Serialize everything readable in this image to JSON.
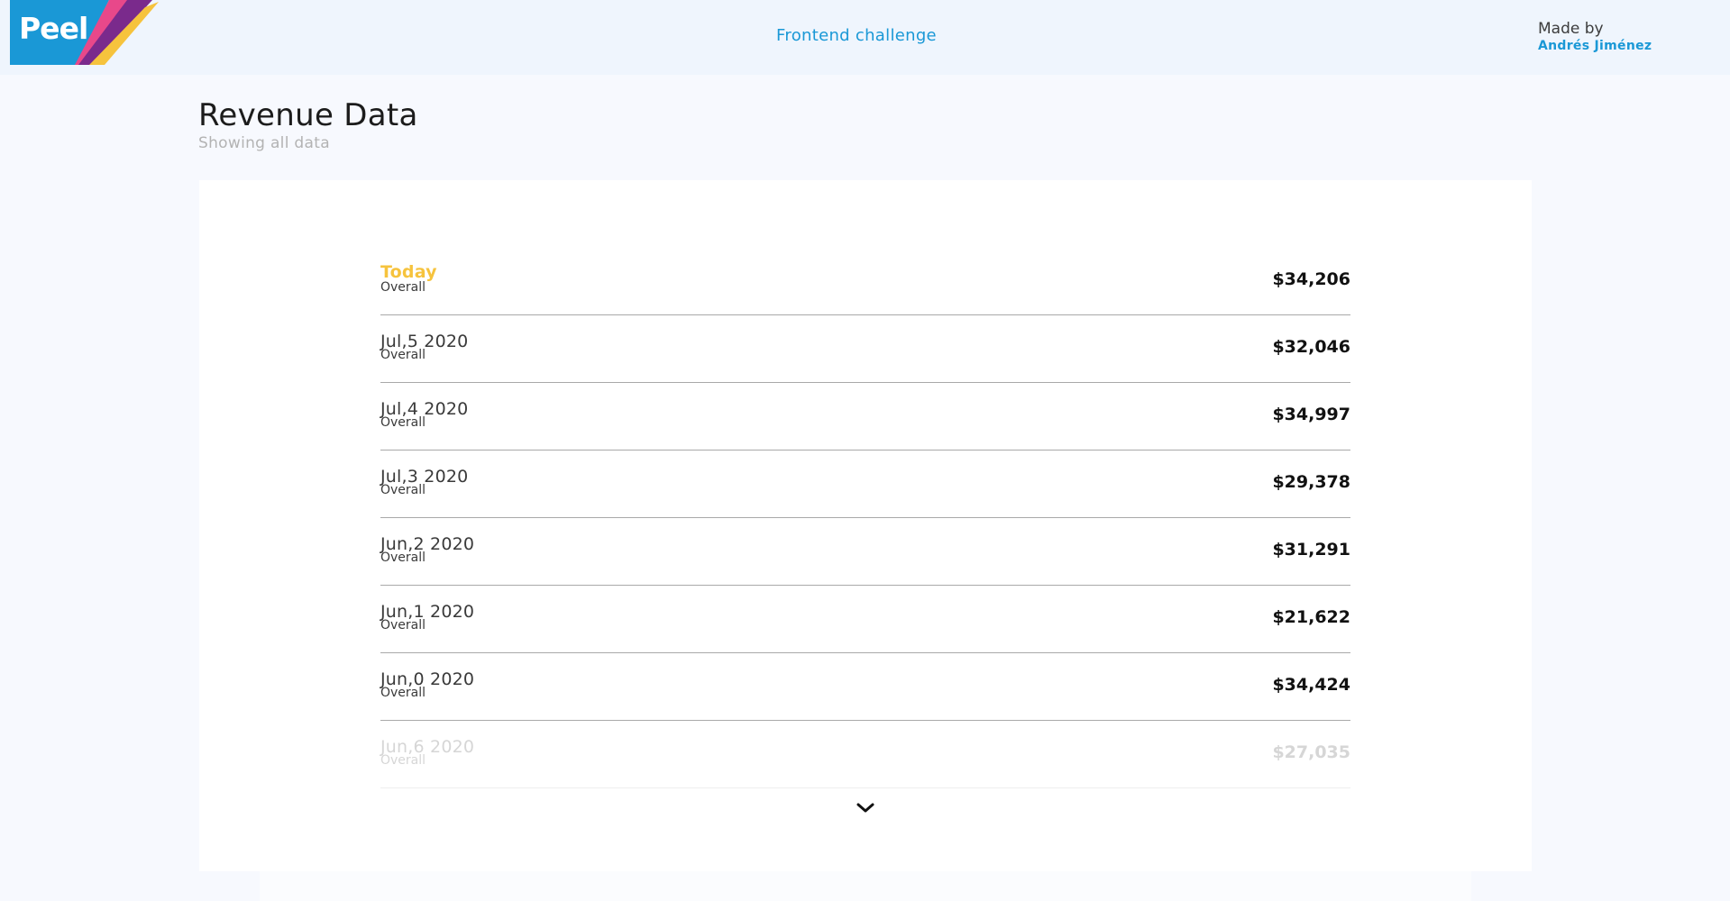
{
  "header": {
    "logo_text": "Peel",
    "nav_link": "Frontend challenge",
    "made_by_label": "Made by",
    "author": "Andrés Jiménez"
  },
  "page": {
    "title": "Revenue Data",
    "subtitle": "Showing all data"
  },
  "rows": [
    {
      "label": "Today",
      "sub": "Overall",
      "value": "$34,206"
    },
    {
      "label": "Jul,5 2020",
      "sub": "Overall",
      "value": "$32,046"
    },
    {
      "label": "Jul,4 2020",
      "sub": "Overall",
      "value": "$34,997"
    },
    {
      "label": "Jul,3 2020",
      "sub": "Overall",
      "value": "$29,378"
    },
    {
      "label": "Jun,2 2020",
      "sub": "Overall",
      "value": "$31,291"
    },
    {
      "label": "Jun,1 2020",
      "sub": "Overall",
      "value": "$21,622"
    },
    {
      "label": "Jun,0 2020",
      "sub": "Overall",
      "value": "$34,424"
    },
    {
      "label": "Jun,6 2020",
      "sub": "Overall",
      "value": "$27,035"
    }
  ],
  "icons": {
    "expand": "chevron-down-icon"
  },
  "colors": {
    "brand_blue": "#1a98d6",
    "highlight_yellow": "#f6c33d",
    "logo_purple": "#7a2a8c",
    "logo_pink": "#e8488a"
  }
}
